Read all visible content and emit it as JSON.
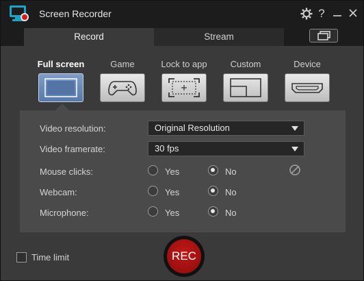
{
  "titlebar": {
    "title": "Screen Recorder"
  },
  "tabs": [
    {
      "label": "Record",
      "active": true
    },
    {
      "label": "Stream",
      "active": false
    }
  ],
  "modes": [
    {
      "label": "Full screen",
      "icon": "fullscreen-icon",
      "active": true
    },
    {
      "label": "Game",
      "icon": "gamepad-icon",
      "active": false
    },
    {
      "label": "Lock to app",
      "icon": "lock-to-app-icon",
      "active": false
    },
    {
      "label": "Custom",
      "icon": "custom-region-icon",
      "active": false
    },
    {
      "label": "Device",
      "icon": "hdmi-icon",
      "active": false
    }
  ],
  "options": {
    "video_resolution": {
      "label": "Video resolution:",
      "value": "Original Resolution"
    },
    "video_framerate": {
      "label": "Video framerate:",
      "value": "30 fps"
    },
    "mouse_clicks": {
      "label": "Mouse clicks:",
      "yes": "Yes",
      "no": "No",
      "selected": "No"
    },
    "webcam": {
      "label": "Webcam:",
      "yes": "Yes",
      "no": "No",
      "selected": "No"
    },
    "microphone": {
      "label": "Microphone:",
      "yes": "Yes",
      "no": "No",
      "selected": "No"
    }
  },
  "footer": {
    "time_limit_label": "Time limit",
    "time_limit_checked": false,
    "rec_label": "REC"
  },
  "colors": {
    "accent": "#6a8cbc",
    "rec": "#b01515",
    "background": "#3a3a3a",
    "panel": "#4a4a4a"
  }
}
